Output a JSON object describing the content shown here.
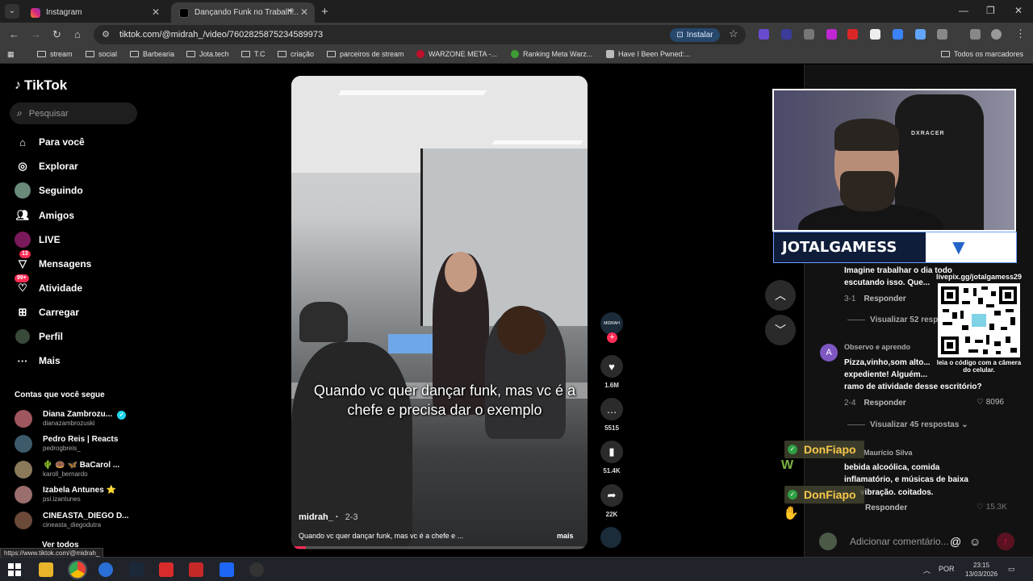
{
  "browser": {
    "tabs": [
      {
        "title": "Instagram",
        "color": "#d6249f"
      },
      {
        "title": "Dançando Funk no Trabalh...",
        "color": "#111111"
      }
    ],
    "url": "tiktok.com/@midrah_/video/7602825875234589973",
    "install_label": "Instalar",
    "bookmarks": [
      "stream",
      "social",
      "Barbearia",
      "Jota.tech",
      "T.C",
      "criação",
      "parceiros de stream",
      "WARZONE META -...",
      "Ranking Meta Warz...",
      "Have I Been Pwned:..."
    ],
    "all_bookmarks": "Todos os marcadores",
    "status_url": "https://www.tiktok.com/@midrah_"
  },
  "sidebar": {
    "logo": "TikTok",
    "search_placeholder": "Pesquisar",
    "nav": [
      {
        "label": "Para você",
        "icon": "home-icon"
      },
      {
        "label": "Explorar",
        "icon": "compass-icon"
      },
      {
        "label": "Seguindo",
        "icon": "following-avatar-icon"
      },
      {
        "label": "Amigos",
        "icon": "friends-icon"
      },
      {
        "label": "LIVE",
        "icon": "live-icon"
      },
      {
        "label": "Mensagens",
        "icon": "messages-icon",
        "badge": "13"
      },
      {
        "label": "Atividade",
        "icon": "activity-icon",
        "badge": "99+"
      },
      {
        "label": "Carregar",
        "icon": "upload-icon"
      },
      {
        "label": "Perfil",
        "icon": "profile-icon"
      },
      {
        "label": "Mais",
        "icon": "more-icon"
      }
    ],
    "following_header": "Contas que você segue",
    "accounts": [
      {
        "name": "Diana Zambrozu...",
        "handle": "dianazambrozuski",
        "verified": true,
        "color": "#a0565f"
      },
      {
        "name": "Pedro Reis | Reacts",
        "handle": "pedrogbreis_",
        "color": "#3d5a6b"
      },
      {
        "name": "🌵 🍩 🦋 BaCarol ...",
        "handle": "karoll_bernardo",
        "color": "#8a7a5a"
      },
      {
        "name": "Izabela Antunes ⭐",
        "handle": "psi.izantunes",
        "color": "#9b6e6e"
      },
      {
        "name": "CINEASTA_DIEGO D...",
        "handle": "cineasta_diegodutra",
        "color": "#6b4a3a"
      }
    ],
    "see_all": "Ver todos"
  },
  "video": {
    "caption": "Quando vc quer dançar funk, mas vc é a chefe e precisa dar o exemplo",
    "author": "midrah_",
    "date": "2-3",
    "description": "Quando vc quer dançar funk, mas vc é a chefe e ...",
    "more": "mais",
    "progress": 0.05
  },
  "actions": {
    "likes": "1.6M",
    "comments": "5515",
    "saves": "51.4K",
    "shares": "22K"
  },
  "comments": [
    {
      "text1": "Imagine trabalhar o dia todo",
      "text2": "escutando isso. Que...",
      "date": "3-1",
      "reply": "Responder",
      "view": "Visualizar 52 respostas"
    },
    {
      "name": "Observo e aprendo",
      "avatar_letter": "A",
      "text1": "Pizza,vinho,som alto...",
      "text2": "expediente! Alguém...",
      "text3": "ramo de atividade desse escritório?",
      "date": "2-4",
      "reply": "Responder",
      "likes": "8096",
      "view": "Visualizar 45 respostas"
    },
    {
      "name": "Maurício Silva",
      "text1": "bebida alcoólica, comida",
      "text2": "inflamatório, e músicas de baixa",
      "text3": "vibração. coitados.",
      "reply": "Responder",
      "likes": "15.3K"
    }
  ],
  "add_comment_placeholder": "Adicionar comentário...",
  "overlay": {
    "channel": "JOTALGAMESS",
    "webcam_brand": "DXRACER",
    "qr_url": "livepix.gg/jotalgamess29",
    "qr_caption": "leia o código com a câmera do celular.",
    "chat_user": "DonFiapo"
  },
  "taskbar": {
    "language": "POR",
    "time": "23:15",
    "date": "13/03/2026"
  }
}
